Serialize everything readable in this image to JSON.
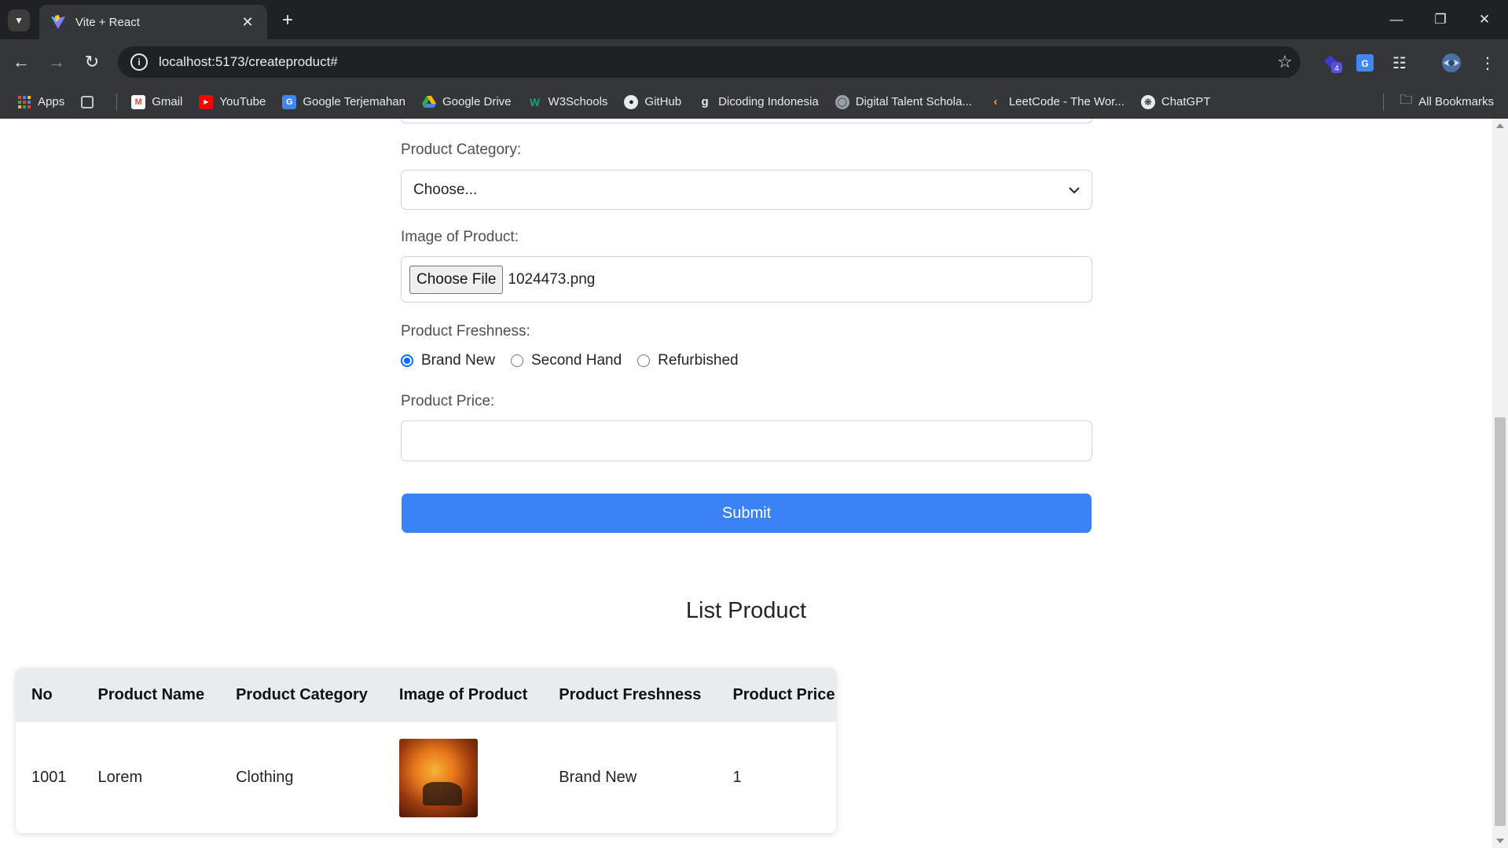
{
  "browser": {
    "tab_title": "Vite + React",
    "url": "localhost:5173/createproduct#",
    "extension_badge": "4",
    "bookmarks": [
      {
        "label": "Apps",
        "icon": "apps-grid-icon"
      },
      {
        "label": "",
        "icon": "tab-groups-icon"
      },
      {
        "label": "Gmail",
        "icon": "gmail-icon"
      },
      {
        "label": "YouTube",
        "icon": "youtube-icon"
      },
      {
        "label": "Google Terjemahan",
        "icon": "google-translate-icon"
      },
      {
        "label": "Google Drive",
        "icon": "google-drive-icon"
      },
      {
        "label": "W3Schools",
        "icon": "w3schools-icon"
      },
      {
        "label": "GitHub",
        "icon": "github-icon"
      },
      {
        "label": "Dicoding Indonesia",
        "icon": "dicoding-icon"
      },
      {
        "label": "Digital Talent Schola...",
        "icon": "globe-icon"
      },
      {
        "label": "LeetCode - The Wor...",
        "icon": "leetcode-icon"
      },
      {
        "label": "ChatGPT",
        "icon": "chatgpt-icon"
      }
    ],
    "all_bookmarks": "All Bookmarks"
  },
  "form": {
    "category_label": "Product Category:",
    "category_value": "Choose...",
    "image_label": "Image of Product:",
    "choose_file_label": "Choose File",
    "file_name": "1024473.png",
    "freshness_label": "Product Freshness:",
    "freshness_options": [
      "Brand New",
      "Second Hand",
      "Refurbished"
    ],
    "freshness_selected": "Brand New",
    "price_label": "Product Price:",
    "price_value": "",
    "submit_label": "Submit"
  },
  "list": {
    "title": "List Product",
    "columns": [
      "No",
      "Product Name",
      "Product Category",
      "Image of Product",
      "Product Freshness",
      "Product Price"
    ],
    "rows": [
      {
        "no": "1001",
        "name": "Lorem",
        "category": "Clothing",
        "freshness": "Brand New",
        "price": "1"
      }
    ]
  },
  "colors": {
    "accent": "#3b82f6",
    "radio": "#0d6efd"
  }
}
